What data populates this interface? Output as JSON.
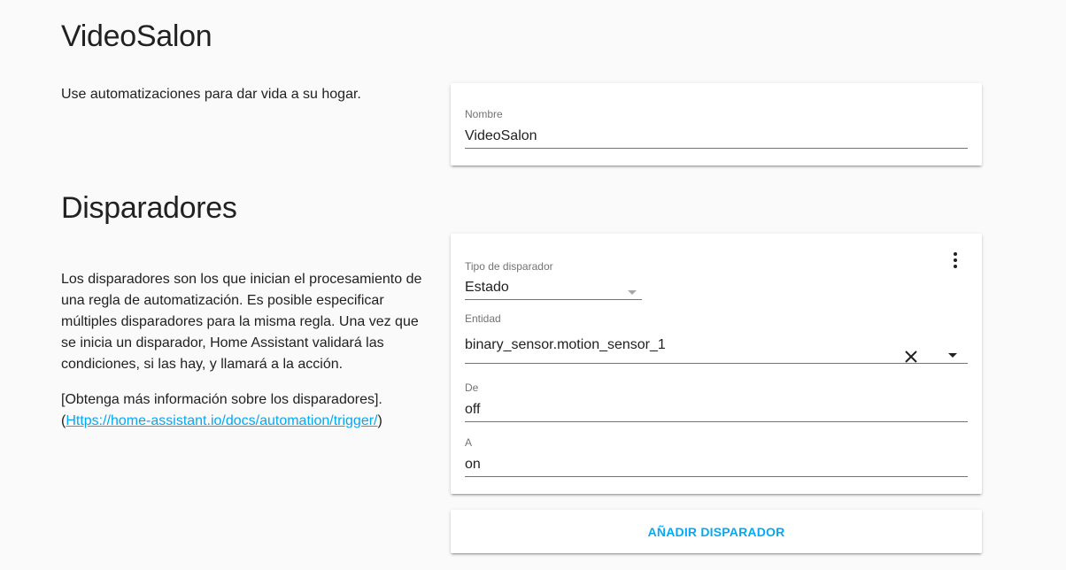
{
  "automation": {
    "title": "VideoSalon",
    "intro": "Use automatizaciones para dar vida a su hogar.",
    "name_label": "Nombre",
    "name_value": "VideoSalon"
  },
  "triggers": {
    "title": "Disparadores",
    "description": "Los disparadores son los que inician el procesamiento de una regla de automatización. Es posible especificar múltiples disparadores para la misma regla. Una vez que se inicia un disparador, Home Assistant validará las condiciones, si las hay, y llamará a la acción.",
    "more_info_text": "[Obtenga más información sobre los disparadores].",
    "link_open": "(",
    "link_text": "Https://home-assistant.io/docs/automation/trigger/",
    "link_close": ")",
    "trigger": {
      "type_label": "Tipo de disparador",
      "type_value": "Estado",
      "entity_label": "Entidad",
      "entity_value": "binary_sensor.motion_sensor_1",
      "from_label": "De",
      "from_value": "off",
      "to_label": "A",
      "to_value": "on"
    },
    "add_button": "AÑADIR DISPARADOR"
  },
  "icons": {
    "menu": "more-vert-icon",
    "clear": "close-icon",
    "dropdown": "arrow-drop-down-icon"
  },
  "colors": {
    "accent": "#03a9f4",
    "background": "#fafafa",
    "card": "#ffffff"
  }
}
